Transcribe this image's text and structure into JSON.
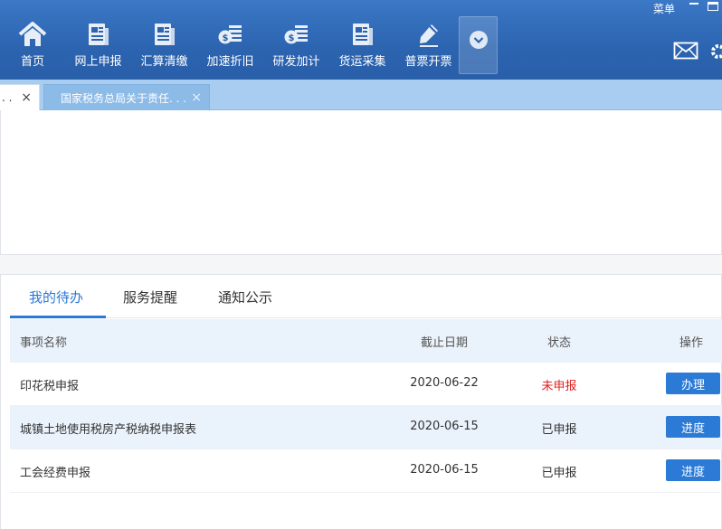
{
  "window": {
    "menu_label": "菜单"
  },
  "nav": {
    "items": [
      {
        "label": "首页",
        "icon": "home-icon"
      },
      {
        "label": "网上申报",
        "icon": "document-icon"
      },
      {
        "label": "汇算清缴",
        "icon": "document-icon"
      },
      {
        "label": "加速折旧",
        "icon": "coin-stack-icon"
      },
      {
        "label": "研发加计",
        "icon": "coin-stack-icon"
      },
      {
        "label": "货运采集",
        "icon": "document-icon"
      },
      {
        "label": "普票开票",
        "icon": "pen-icon"
      }
    ],
    "more_icon": "chevron-down-icon",
    "mail_icon": "mail-icon",
    "settings_icon": "gear-icon"
  },
  "tabs": [
    {
      "label": ". .",
      "close": "×"
    },
    {
      "label": "国家税务总局关于责任. . .",
      "close": "×"
    }
  ],
  "panel": {
    "tabs": [
      "我的待办",
      "服务提醒",
      "通知公示"
    ],
    "columns": {
      "name": "事项名称",
      "deadline": "截止日期",
      "status": "状态",
      "action": "操作"
    },
    "rows": [
      {
        "name": "印花税申报",
        "deadline": "2020-06-22",
        "status": "未申报",
        "action": "办理"
      },
      {
        "name": "城镇土地使用税房产税纳税申报表",
        "deadline": "2020-06-15",
        "status": "已申报",
        "action": "进度"
      },
      {
        "name": "工会经费申报",
        "deadline": "2020-06-15",
        "status": "已申报",
        "action": "进度"
      }
    ]
  },
  "colors": {
    "toolbar": "#2c64b0",
    "accent": "#2d78d6",
    "status_pending": "#e02020"
  }
}
